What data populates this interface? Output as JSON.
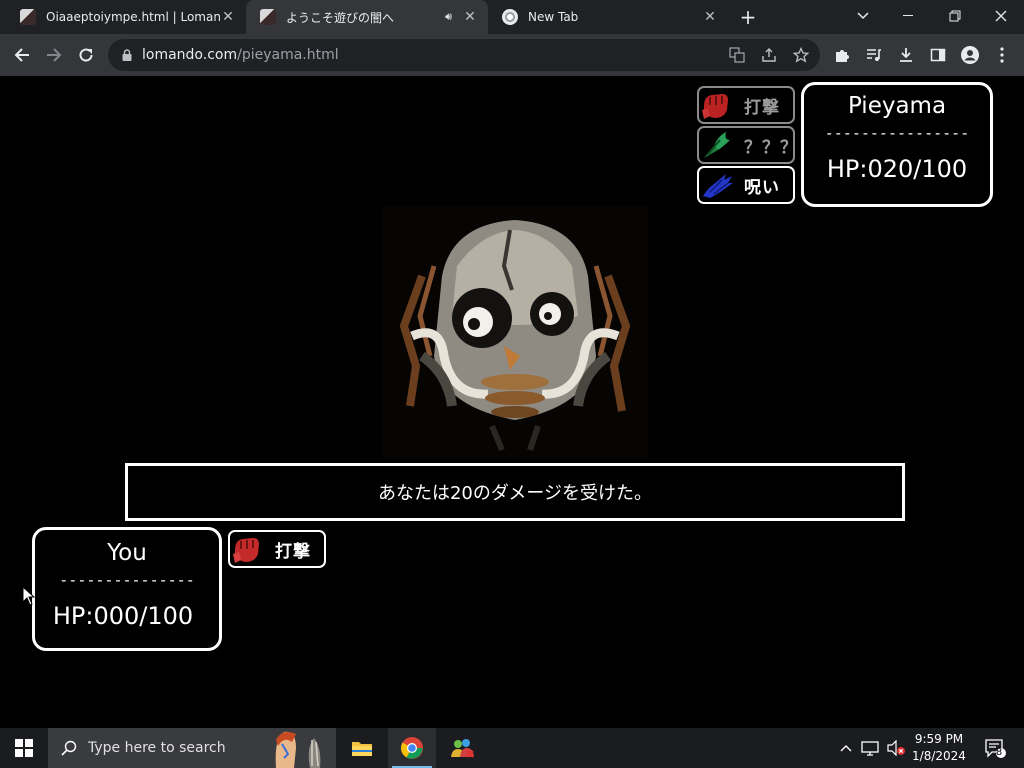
{
  "browser": {
    "tabs": [
      {
        "title": "Oiaaeptoiympe.html | Lomando",
        "active": false
      },
      {
        "title": "ようこそ遊びの闇へ",
        "active": true,
        "audio": true
      },
      {
        "title": "New Tab",
        "active": false
      }
    ],
    "url_host": "lomando.com",
    "url_path": "/pieyama.html"
  },
  "game": {
    "enemy": {
      "name": "Pieyama",
      "divider": "----------------",
      "hp": "HP:020/100",
      "skills": [
        {
          "label": "打撃",
          "icon": "fist-icon",
          "enabled": false
        },
        {
          "label": "？？？",
          "icon": "green-claw-icon",
          "enabled": false
        },
        {
          "label": "呪い",
          "icon": "blue-hand-icon",
          "enabled": true
        }
      ]
    },
    "message": "あなたは20のダメージを受けた。",
    "player": {
      "name": "You",
      "divider": "---------------",
      "hp": "HP:000/100",
      "skills": [
        {
          "label": "打撃",
          "icon": "fist-icon",
          "enabled": true
        }
      ]
    }
  },
  "taskbar": {
    "search_placeholder": "Type here to search",
    "time": "9:59 PM",
    "date": "1/8/2024",
    "notification_count": "8"
  },
  "colors": {
    "background": "#000000",
    "border": "#ffffff",
    "disabled_border": "#8a8a8a",
    "tabbar": "#202124",
    "toolbar": "#35363a"
  }
}
